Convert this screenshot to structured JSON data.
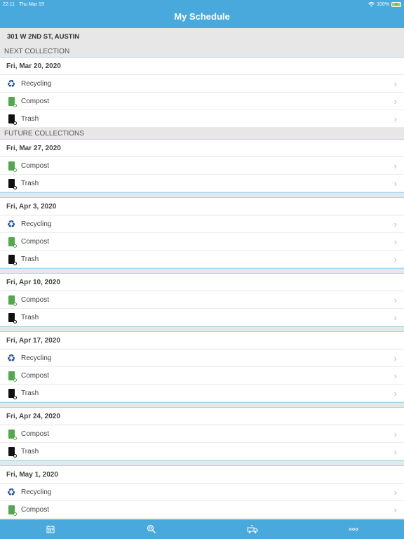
{
  "status": {
    "time": "22:11",
    "date": "Thu Mar 19",
    "battery": "100%"
  },
  "nav": {
    "title": "My Schedule"
  },
  "address": "301 W 2ND ST, AUSTIN",
  "next_header": "NEXT COLLECTION",
  "future_header": "FUTURE COLLECTIONS",
  "items_labels": {
    "recycling": "Recycling",
    "compost": "Compost",
    "trash": "Trash"
  },
  "dates": {
    "d0": "Fri, Mar 20, 2020",
    "d1": "Fri, Mar 27, 2020",
    "d2": "Fri, Apr 3, 2020",
    "d3": "Fri, Apr 10, 2020",
    "d4": "Fri, Apr 17, 2020",
    "d5": "Fri, Apr 24, 2020",
    "d6": "Fri, May 1, 2020"
  },
  "tabs": [
    {
      "icon": "calendar-icon"
    },
    {
      "icon": "magnifier-icon"
    },
    {
      "icon": "truck-icon"
    },
    {
      "icon": "more-icon"
    }
  ],
  "colors": {
    "accent": "#4aa9dc",
    "recycle": "#1d4f9e",
    "compost": "#51a84d",
    "trash": "#111111"
  }
}
